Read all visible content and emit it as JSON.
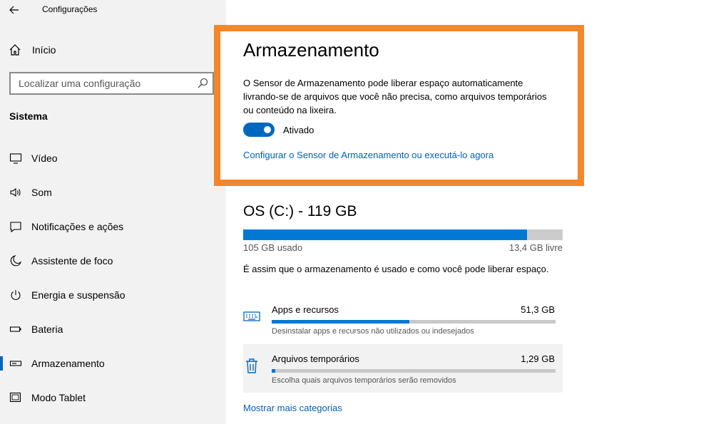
{
  "window": {
    "title": "Configurações"
  },
  "sidebar": {
    "home_label": "Início",
    "search_placeholder": "Localizar uma configuração",
    "section_title": "Sistema",
    "items": [
      {
        "label": "Vídeo",
        "icon": "monitor-icon"
      },
      {
        "label": "Som",
        "icon": "speaker-icon"
      },
      {
        "label": "Notificações e ações",
        "icon": "notification-icon"
      },
      {
        "label": "Assistente de foco",
        "icon": "moon-icon"
      },
      {
        "label": "Energia e suspensão",
        "icon": "power-icon"
      },
      {
        "label": "Bateria",
        "icon": "battery-icon"
      },
      {
        "label": "Armazenamento",
        "icon": "storage-icon",
        "active": true
      },
      {
        "label": "Modo Tablet",
        "icon": "tablet-icon"
      }
    ]
  },
  "main": {
    "title": "Armazenamento",
    "description": "O Sensor de Armazenamento pode liberar espaço automaticamente livrando-se de arquivos que você não precisa, como arquivos temporários ou conteúdo na lixeira.",
    "toggle": {
      "state": "on",
      "label": "Ativado"
    },
    "configure_link": "Configurar o Sensor de Armazenamento ou executá-lo agora",
    "drive": {
      "title": "OS (C:) - 119 GB",
      "used_label": "105 GB usado",
      "free_label": "13,4 GB livre",
      "used_fraction": 0.888
    },
    "usage_description": "É assim que o armazenamento é usado e como você pode liberar espaço.",
    "categories": [
      {
        "name": "Apps e recursos",
        "size": "51,3 GB",
        "subtitle": "Desinstalar apps e recursos não utilizados ou indesejados",
        "fraction": 0.485,
        "icon": "keyboard-icon"
      },
      {
        "name": "Arquivos temporários",
        "size": "1,29 GB",
        "subtitle": "Escolha quais arquivos temporários serão removidos",
        "fraction": 0.012,
        "icon": "trash-icon"
      }
    ],
    "more_link": "Mostrar mais categorias"
  },
  "colors": {
    "accent": "#0078d4",
    "link": "#0060b5",
    "highlight": "#f4862c",
    "sidebar_bg": "#f2f2f2"
  }
}
